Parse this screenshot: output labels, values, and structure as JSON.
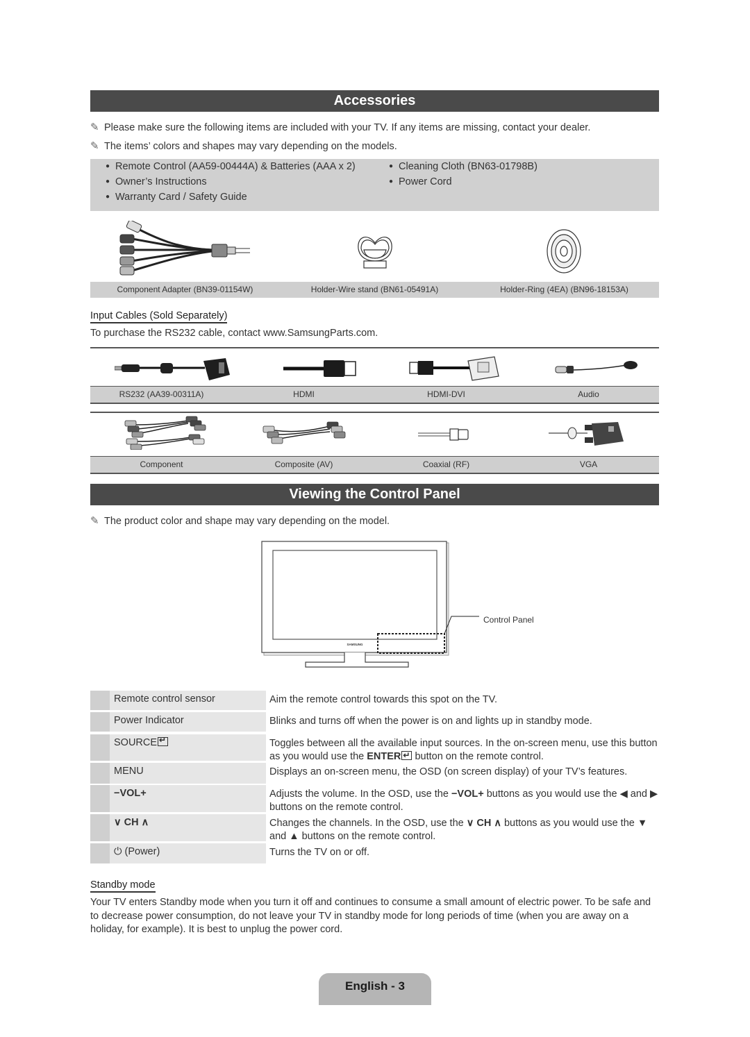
{
  "accessories": {
    "title": "Accessories",
    "notes": [
      "Please make sure the following items are included with your TV. If any items are missing, contact your dealer.",
      "The items’ colors and shapes may vary depending on the models."
    ],
    "included_items_left": [
      "Remote Control (AA59-00444A) & Batteries (AAA x 2)",
      "Owner’s Instructions",
      "Warranty Card / Safety Guide"
    ],
    "included_items_right": [
      "Cleaning Cloth (BN63-01798B)",
      "Power Cord"
    ],
    "bullet_glyph": "●",
    "parts": [
      {
        "label": "Component Adapter (BN39-01154W)",
        "icon": "component-adapter-icon"
      },
      {
        "label": "Holder-Wire stand (BN61-05491A)",
        "icon": "holder-wire-stand-icon"
      },
      {
        "label": "Holder-Ring (4EA) (BN96-18153A)",
        "icon": "holder-ring-icon"
      }
    ]
  },
  "input_cables": {
    "heading": "Input Cables (Sold Separately)",
    "note": "To purchase the RS232 cable, contact www.SamsungParts.com.",
    "row1": [
      {
        "label": "RS232 (AA39-00311A)",
        "icon": "rs232-cable-icon"
      },
      {
        "label": "HDMI",
        "icon": "hdmi-cable-icon"
      },
      {
        "label": "HDMI-DVI",
        "icon": "hdmi-dvi-cable-icon"
      },
      {
        "label": "Audio",
        "icon": "audio-cable-icon"
      }
    ],
    "row2": [
      {
        "label": "Component",
        "icon": "component-cable-icon"
      },
      {
        "label": "Composite (AV)",
        "icon": "composite-cable-icon"
      },
      {
        "label": "Coaxial (RF)",
        "icon": "coaxial-cable-icon"
      },
      {
        "label": "VGA",
        "icon": "vga-cable-icon"
      }
    ]
  },
  "control_panel": {
    "title": "Viewing the Control Panel",
    "note": "The product color and shape may vary depending on the model.",
    "diagram_callout": "Control Panel",
    "tv_brand": "SAMSUNG",
    "rows": [
      {
        "label": "Remote control sensor",
        "description": "Aim the remote control towards this spot on the TV."
      },
      {
        "label": "Power Indicator",
        "description": "Blinks and turns off when the power is on and lights up in standby mode."
      },
      {
        "label": "SOURCE",
        "description_a": "Toggles between all the available input sources. In the on-screen menu, use this button as you would use the ",
        "description_bold": "ENTER",
        "description_b": " button on the remote control."
      },
      {
        "label": "MENU",
        "description": "Displays an on-screen menu, the OSD (on screen display) of your TV’s features."
      },
      {
        "label": "−VOL+",
        "description_a": "Adjusts the volume. In the OSD, use the ",
        "description_bold": "−VOL+",
        "description_b": " buttons as you would use the ◀ and ▶ buttons on the remote control."
      },
      {
        "label": "CH",
        "description_a": "Changes the channels. In the OSD, use the ",
        "description_bold": "∨ CH ∧",
        "description_b": " buttons as you would use the ▼ and ▲ buttons on the remote control."
      },
      {
        "label": "(Power)",
        "description": "Turns the TV on or off."
      }
    ]
  },
  "standby": {
    "heading": "Standby mode",
    "text": "Your TV enters Standby mode when you turn it off and continues to consume a small amount of electric power. To be safe and to decrease power consumption, do not leave your TV in standby mode for long periods of time (when you are away on a holiday, for example). It is best to unplug the power cord."
  },
  "footer": {
    "page_label": "English - 3"
  }
}
